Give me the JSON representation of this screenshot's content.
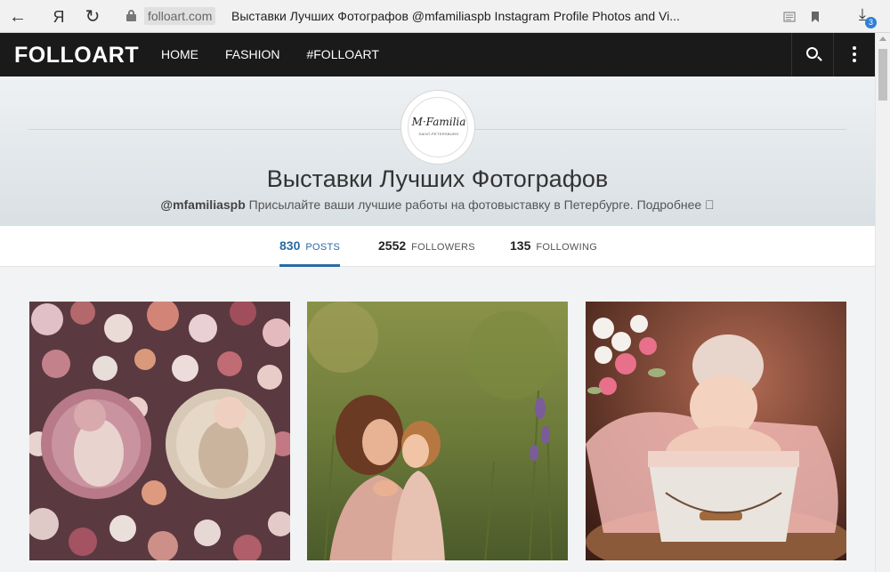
{
  "browser": {
    "back_glyph": "←",
    "yandex_glyph": "Я",
    "reload_glyph": "↻",
    "domain": "folloart.com",
    "page_title": "Выставки Лучших Фотографов @mfamiliaspb Instagram Profile Photos and Vi...",
    "downloads_count": "3"
  },
  "site": {
    "logo": "FOLLOART",
    "menu": [
      {
        "label": "HOME"
      },
      {
        "label": "FASHION"
      },
      {
        "label": "#FOLLOART"
      }
    ]
  },
  "profile": {
    "avatar_script": "M·Familia",
    "avatar_sub": "SAINT-PETERSBURG",
    "name": "Выставки Лучших Фотографов",
    "username": "@mfamiliaspb",
    "bio": " Присылайте ваши лучшие работы на фотовыставку в Петербурге. Подробнее ⃞"
  },
  "stats": [
    {
      "num": "830",
      "label": "POSTS"
    },
    {
      "num": "2552",
      "label": "FOLLOWERS"
    },
    {
      "num": "135",
      "label": "FOLLOWING"
    }
  ],
  "colors": {
    "accent": "#2b6aa3",
    "header_bg": "#1a1a1a"
  }
}
